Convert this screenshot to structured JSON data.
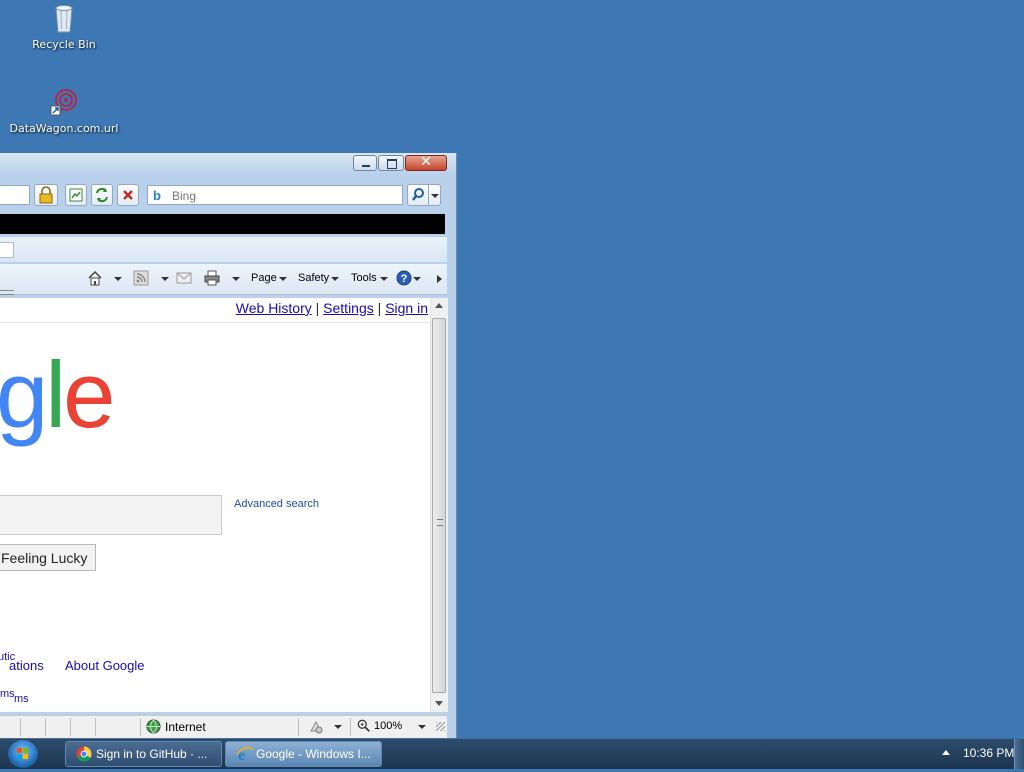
{
  "desktop": {
    "icons": [
      {
        "label": "Recycle Bin",
        "icon": "recycle-bin-icon"
      },
      {
        "label": "DataWagon.com.url",
        "icon": "url-shortcut-icon"
      }
    ]
  },
  "ie": {
    "search_placeholder": "Bing",
    "cmdbar": {
      "page": "Page",
      "safety": "Safety",
      "tools": "Tools"
    },
    "content": {
      "links": {
        "web_history": "Web History",
        "settings": "Settings",
        "sign_in": "Sign in",
        "sep": "|"
      },
      "logo": {
        "g": "g",
        "l": "l",
        "e": "e"
      },
      "advanced_search": "Advanced search",
      "lucky_button": "Feeling Lucky",
      "footer_fragment_top": "utic",
      "footer_fragment": "ations",
      "about_google": "About Google",
      "footer_ms_top": "ms",
      "footer_ms": "ms"
    },
    "status": {
      "zone": "Internet",
      "zoom": "100%"
    }
  },
  "taskbar": {
    "items": [
      {
        "label": "Sign in to GitHub · ...",
        "app": "chrome-icon"
      },
      {
        "label": "Google - Windows I...",
        "app": "ie-icon"
      }
    ],
    "clock": "10:36 PM"
  },
  "colors": {
    "desktop": "#3d78b4",
    "google_blue": "#4285f4",
    "google_green": "#34a853",
    "google_red": "#ea4335"
  }
}
